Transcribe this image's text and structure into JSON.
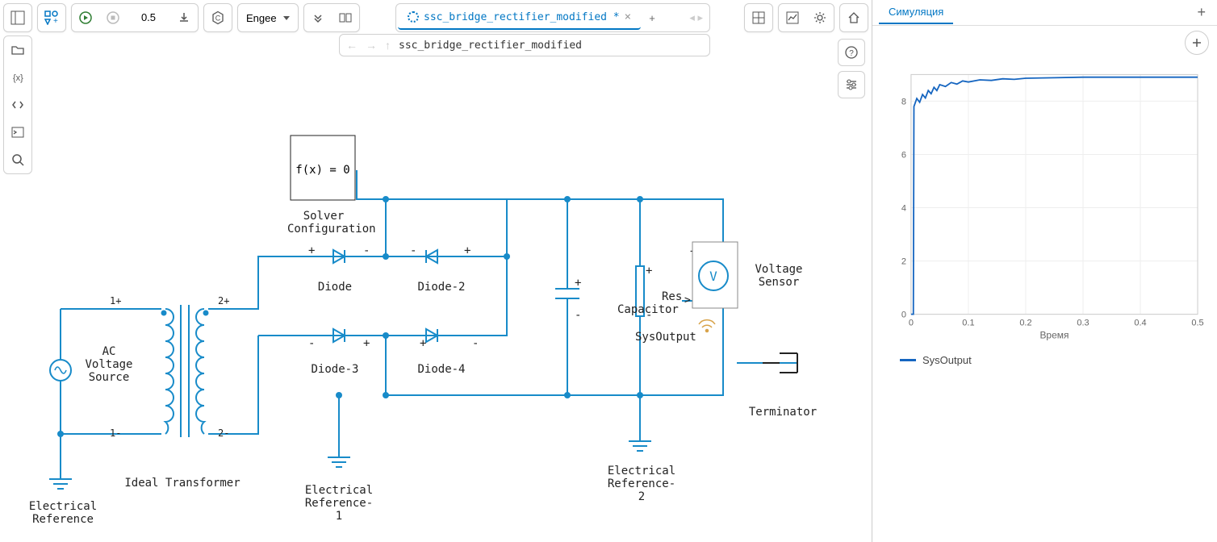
{
  "toolbar": {
    "time_value": "0.5",
    "engine": "Engee"
  },
  "tab": {
    "title": "ssc_bridge_rectifier_modified *"
  },
  "breadcrumb": {
    "path": "ssc_bridge_rectifier_modified"
  },
  "blocks": {
    "solver_cfg": {
      "text": "f(x) = 0",
      "label": "Solver\nConfiguration"
    },
    "ac_source": {
      "label": "AC\nVoltage\nSource"
    },
    "transformer": {
      "label": "Ideal Transformer",
      "p1p": "1+",
      "p1m": "1-",
      "p2p": "2+",
      "p2m": "2-"
    },
    "diode": {
      "label": "Diode"
    },
    "diode2": {
      "label": "Diode-2"
    },
    "diode3": {
      "label": "Diode-3"
    },
    "diode4": {
      "label": "Diode-4"
    },
    "eref": {
      "label": "Electrical\nReference"
    },
    "eref1": {
      "label": "Electrical\nReference-\n1"
    },
    "eref2": {
      "label": "Electrical\nReference-\n2"
    },
    "res": {
      "label": "Res"
    },
    "cap": {
      "label": "Capacitor"
    },
    "sysout": {
      "label": "SysOutput"
    },
    "vsensor": {
      "label": "Voltage\nSensor",
      "v": "V"
    },
    "terminator": {
      "label": "Terminator"
    }
  },
  "sim_panel": {
    "tab": "Симуляция",
    "xlabel": "Время",
    "legend_series": "SysOutput"
  },
  "chart_data": {
    "type": "line",
    "title": "",
    "xlabel": "Время",
    "ylabel": "",
    "xlim": [
      0,
      0.5
    ],
    "ylim": [
      0,
      9
    ],
    "x_ticks": [
      0,
      0.1,
      0.2,
      0.3,
      0.4,
      0.5
    ],
    "y_ticks": [
      0,
      2,
      4,
      6,
      8
    ],
    "series": [
      {
        "name": "SysOutput",
        "color": "#1565c0",
        "x": [
          0,
          0.004,
          0.005,
          0.01,
          0.015,
          0.02,
          0.025,
          0.03,
          0.035,
          0.04,
          0.045,
          0.05,
          0.06,
          0.07,
          0.08,
          0.09,
          0.1,
          0.12,
          0.14,
          0.16,
          0.18,
          0.2,
          0.25,
          0.3,
          0.35,
          0.4,
          0.45,
          0.5
        ],
        "values": [
          0,
          0,
          7.8,
          8.1,
          7.96,
          8.25,
          8.12,
          8.4,
          8.28,
          8.52,
          8.4,
          8.62,
          8.55,
          8.7,
          8.64,
          8.76,
          8.72,
          8.8,
          8.78,
          8.84,
          8.82,
          8.86,
          8.88,
          8.9,
          8.9,
          8.9,
          8.9,
          8.9
        ]
      }
    ]
  }
}
